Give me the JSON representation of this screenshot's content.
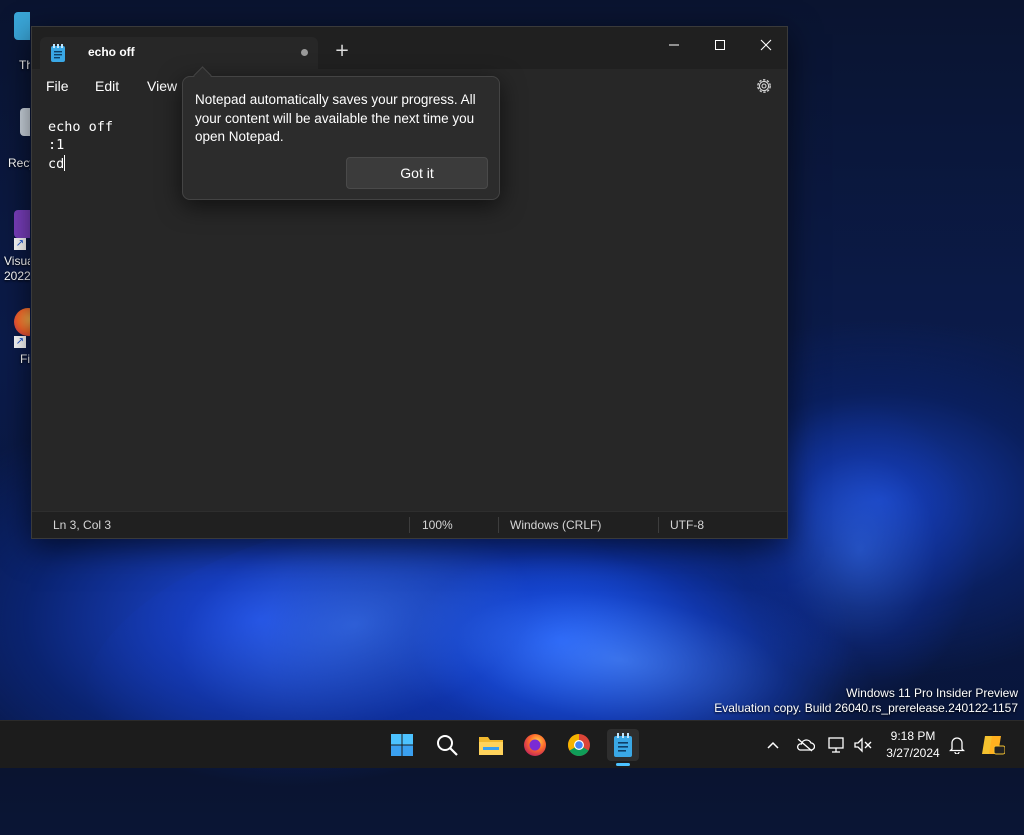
{
  "desktop": {
    "icons": [
      {
        "label": "Th"
      },
      {
        "label": "Recy"
      },
      {
        "label": "Visua",
        "label2": "2022"
      },
      {
        "label": "Fi"
      }
    ],
    "watermark_line1": "Windows 11 Pro Insider Preview",
    "watermark_line2": "Evaluation copy. Build 26040.rs_prerelease.240122-1157"
  },
  "notepad": {
    "tab_title": "echo off",
    "new_tab_label": "+",
    "menu": [
      "File",
      "Edit",
      "View"
    ],
    "content_lines": [
      "echo off",
      ":1",
      "cd"
    ],
    "status": {
      "position": "Ln 3, Col 3",
      "zoom": "100%",
      "line_ending": "Windows (CRLF)",
      "encoding": "UTF-8"
    }
  },
  "teaching_tip": {
    "message": "Notepad automatically saves your progress. All your content will be available the next time you open Notepad.",
    "button_label": "Got it"
  },
  "taskbar": {
    "apps": [
      "start-icon",
      "search-icon",
      "file-explorer-icon",
      "firefox-icon",
      "chrome-icon",
      "notepad-icon"
    ],
    "clock_time": "9:18 PM",
    "clock_date": "3/27/2024"
  },
  "colors": {
    "accent": "#4cc2ff",
    "window_bg": "#272727",
    "titlebar_bg": "#202020"
  }
}
